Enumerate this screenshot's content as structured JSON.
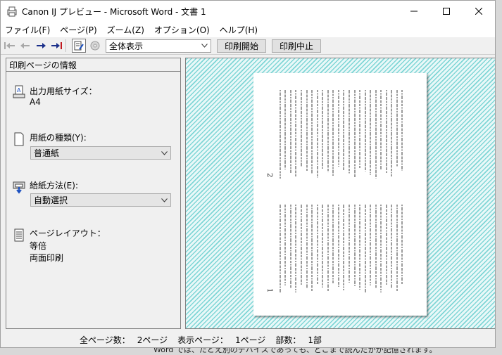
{
  "window": {
    "title": "Canon IJ プレビュー - Microsoft Word - 文書 1"
  },
  "menu": [
    "ファイル(F)",
    "ページ(P)",
    "ズーム(Z)",
    "オプション(O)",
    "ヘルプ(H)"
  ],
  "toolbar": {
    "zoom_value": "全体表示",
    "print_start_label": "印刷開始",
    "print_cancel_label": "印刷中止"
  },
  "panel": {
    "header": "印刷ページの情報",
    "paper_size_label": "出力用紙サイズ：",
    "paper_size_value": "A4",
    "media_type_label": "用紙の種類(Y):",
    "media_type_value": "普通紙",
    "paper_source_label": "給紙方法(E):",
    "paper_source_value": "自動選択",
    "layout_label": "ページレイアウト：",
    "layout_scale": "等倍",
    "layout_duplex": "両面印刷"
  },
  "preview": {
    "page_top_number": "2",
    "page_bottom_number": "1"
  },
  "status": {
    "total_pages_label": "全ページ数：",
    "total_pages_value": "2ページ",
    "shown_page_label": "表示ページ：",
    "shown_page_value": "1ページ",
    "copies_label": "部数：",
    "copies_value": "1部"
  },
  "background_text": "Word では、たとえ別のデバイスであっても、どこまで読んだかが記憶されます。"
}
